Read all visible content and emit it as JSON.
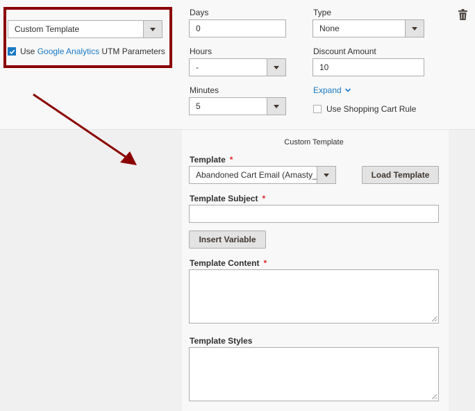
{
  "left": {
    "template_select": {
      "value": "Custom Template"
    },
    "utm": {
      "checked": true,
      "prefix": "Use ",
      "link": "Google Analytics",
      "suffix": " UTM Parameters"
    }
  },
  "timing": {
    "days": {
      "label": "Days",
      "value": "0"
    },
    "hours": {
      "label": "Hours",
      "value": "-"
    },
    "minutes": {
      "label": "Minutes",
      "value": "5"
    }
  },
  "discount": {
    "type": {
      "label": "Type",
      "value": "None"
    },
    "amount": {
      "label": "Discount Amount",
      "value": "10"
    },
    "expand_label": "Expand",
    "cart_rule": {
      "label": "Use Shopping Cart Rule",
      "checked": false
    }
  },
  "custom_template": {
    "heading": "Custom Template",
    "template": {
      "label": "Template",
      "required": "*",
      "value": "Abandoned Cart Email (Amasty_Acart)"
    },
    "load_button": "Load Template",
    "subject": {
      "label": "Template Subject",
      "required": "*",
      "value": ""
    },
    "insert_variable_button": "Insert Variable",
    "content": {
      "label": "Template Content",
      "required": "*"
    },
    "styles": {
      "label": "Template Styles"
    }
  },
  "colors": {
    "highlight_box": "#8b0000",
    "arrow": "#8b0000",
    "link": "#1979c3",
    "required": "#e22626"
  },
  "icons": {
    "delete": "trash-icon",
    "expand": "chevron-down-icon",
    "check": "check-icon"
  }
}
